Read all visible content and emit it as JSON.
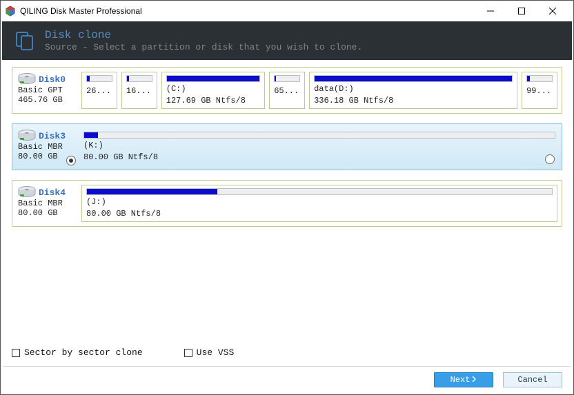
{
  "titlebar": {
    "title": "QILING Disk Master Professional"
  },
  "header": {
    "title": "Disk clone",
    "subtitle": "Source - Select a partition or disk that you wish to clone."
  },
  "disks": [
    {
      "name": "Disk0",
      "type": "Basic GPT",
      "size": "465.76 GB",
      "selected": false,
      "partitions": [
        {
          "label": "",
          "sub": "26...",
          "fill": 12,
          "flex": 5
        },
        {
          "label": "",
          "sub": "16...",
          "fill": 8,
          "flex": 5
        },
        {
          "label": "(C:)",
          "sub": "127.69 GB Ntfs/8",
          "fill": 100,
          "flex": 18
        },
        {
          "label": "",
          "sub": "65...",
          "fill": 6,
          "flex": 5
        },
        {
          "label": "data(D:)",
          "sub": "336.18 GB Ntfs/8",
          "fill": 100,
          "flex": 38
        },
        {
          "label": "",
          "sub": "99...",
          "fill": 10,
          "flex": 5
        }
      ]
    },
    {
      "name": "Disk3",
      "type": "Basic MBR",
      "size": "80.00 GB",
      "selected": true,
      "partitions": [
        {
          "label": "(K:)",
          "sub": "80.00 GB Ntfs/8",
          "fill": 3,
          "flex": 100
        }
      ]
    },
    {
      "name": "Disk4",
      "type": "Basic MBR",
      "size": "80.00 GB",
      "selected": false,
      "partitions": [
        {
          "label": "(J:)",
          "sub": "80.00 GB Ntfs/8",
          "fill": 28,
          "flex": 100
        }
      ]
    }
  ],
  "options": {
    "sector": "Sector by sector clone",
    "vss": "Use VSS"
  },
  "footer": {
    "next": "Next",
    "cancel": "Cancel"
  }
}
